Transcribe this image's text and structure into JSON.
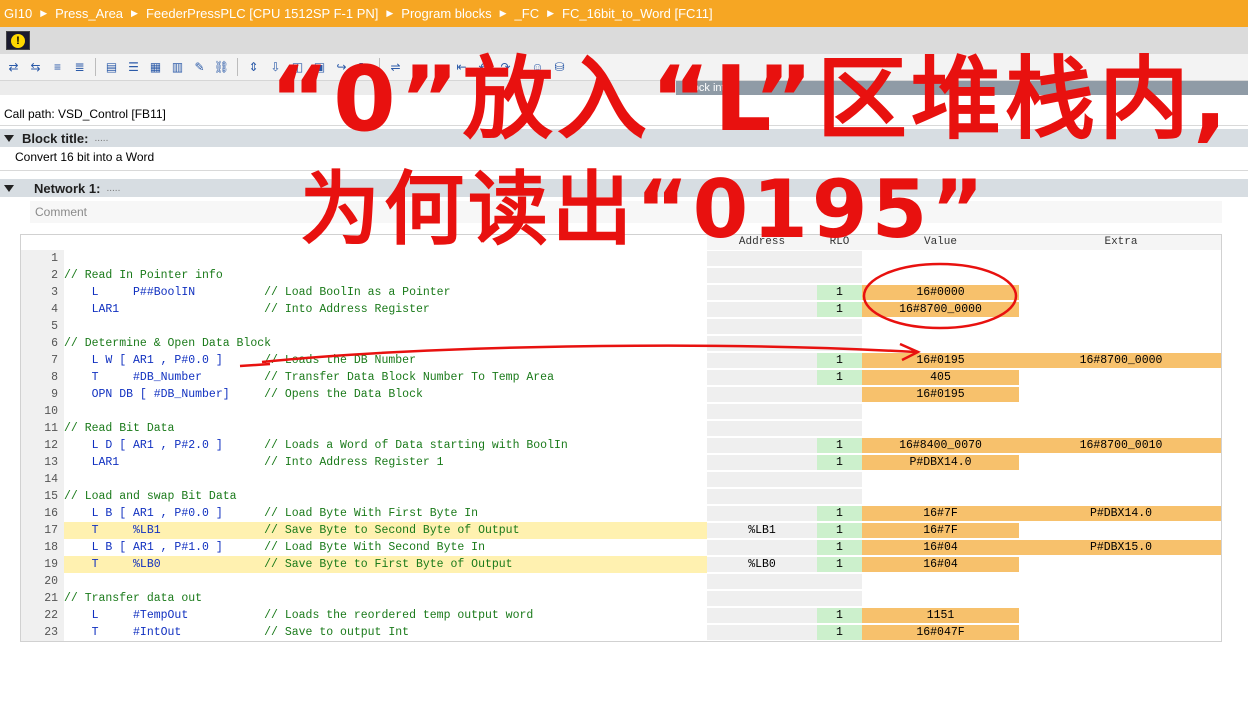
{
  "breadcrumb": [
    "GI10",
    "Press_Area",
    "FeederPressPLC [CPU 1512SP F-1 PN]",
    "Program blocks",
    "_FC",
    "FC_16bit_to_Word [FC11]"
  ],
  "warning_icon": "warning-exclamation-icon",
  "toolbar_icons": [
    "go-online-icon",
    "go-offline-icon",
    "insert-network-icon",
    "delete-network-icon",
    "monitor-icon",
    "list-icon",
    "grid-icon",
    "table-icon",
    "comment-icon",
    "link-icon",
    "scroll-icon",
    "download-icon",
    "view-icon",
    "select-icon",
    "goto-icon",
    "refresh-icon",
    "compare-icon",
    "call-icon",
    "indent-icon",
    "outdent-icon",
    "back-icon",
    "forward-icon",
    "user-icon",
    "database-icon"
  ],
  "block_interface_tab": "Block inte",
  "call_path": "Call path: VSD_Control [FB11]",
  "block_title_label": "Block title:",
  "block_title_dots": ".....",
  "block_description": "Convert 16 bit into a Word",
  "network_label": "Network 1:",
  "network_dots": ".....",
  "network_comment_placeholder": "Comment",
  "columns": {
    "address": "Address",
    "rlo": "RLO",
    "value": "Value",
    "extra": "Extra"
  },
  "code_lines": [
    {
      "n": "1",
      "code": "",
      "kind": "blank"
    },
    {
      "n": "2",
      "code": "// Read In Pointer info",
      "kind": "comment"
    },
    {
      "n": "3",
      "code": "    L     P##BoolIN          // Load BoolIn as a Pointer",
      "kind": "instr",
      "addr": "",
      "rlo": "1",
      "val": "16#0000",
      "ext": ""
    },
    {
      "n": "4",
      "code": "    LAR1                     // Into Address Register",
      "kind": "instr",
      "addr": "",
      "rlo": "1",
      "val": "16#8700_0000",
      "ext": ""
    },
    {
      "n": "5",
      "code": "",
      "kind": "blank"
    },
    {
      "n": "6",
      "code": "// Determine & Open Data Block",
      "kind": "comment"
    },
    {
      "n": "7",
      "code": "    L W [ AR1 , P#0.0 ]      // Loads the DB Number",
      "kind": "instr",
      "addr": "",
      "rlo": "1",
      "val": "16#0195",
      "ext": "16#8700_0000"
    },
    {
      "n": "8",
      "code": "    T     #DB_Number         // Transfer Data Block Number To Temp Area",
      "kind": "instr",
      "addr": "",
      "rlo": "1",
      "val": "405",
      "ext": ""
    },
    {
      "n": "9",
      "code": "    OPN DB [ #DB_Number]     // Opens the Data Block",
      "kind": "instr",
      "addr": "",
      "rlo": "",
      "val": "16#0195",
      "ext": ""
    },
    {
      "n": "10",
      "code": "",
      "kind": "blank"
    },
    {
      "n": "11",
      "code": "// Read Bit Data",
      "kind": "comment"
    },
    {
      "n": "12",
      "code": "    L D [ AR1 , P#2.0 ]      // Loads a Word of Data starting with BoolIn",
      "kind": "instr",
      "addr": "",
      "rlo": "1",
      "val": "16#8400_0070",
      "ext": "16#8700_0010"
    },
    {
      "n": "13",
      "code": "    LAR1                     // Into Address Register 1",
      "kind": "instr",
      "addr": "",
      "rlo": "1",
      "val": "P#DBX14.0",
      "ext": ""
    },
    {
      "n": "14",
      "code": "",
      "kind": "blank"
    },
    {
      "n": "15",
      "code": "// Load and swap Bit Data",
      "kind": "comment"
    },
    {
      "n": "16",
      "code": "    L B [ AR1 , P#0.0 ]      // Load Byte With First Byte In",
      "kind": "instr",
      "addr": "",
      "rlo": "1",
      "val": "16#7F",
      "ext": "P#DBX14.0"
    },
    {
      "n": "17",
      "code": "    T     %LB1               // Save Byte to Second Byte of Output",
      "kind": "instr",
      "hl": true,
      "addr": "%LB1",
      "rlo": "1",
      "val": "16#7F",
      "ext": ""
    },
    {
      "n": "18",
      "code": "    L B [ AR1 , P#1.0 ]      // Load Byte With Second Byte In",
      "kind": "instr",
      "addr": "",
      "rlo": "1",
      "val": "16#04",
      "ext": "P#DBX15.0"
    },
    {
      "n": "19",
      "code": "    T     %LB0               // Save Byte to First Byte of Output",
      "kind": "instr",
      "hl": true,
      "addr": "%LB0",
      "rlo": "1",
      "val": "16#04",
      "ext": ""
    },
    {
      "n": "20",
      "code": "",
      "kind": "blank"
    },
    {
      "n": "21",
      "code": "// Transfer data out",
      "kind": "comment"
    },
    {
      "n": "22",
      "code": "    L     #TempOut           // Loads the reordered temp output word",
      "kind": "instr",
      "addr": "",
      "rlo": "1",
      "val": "1151",
      "ext": ""
    },
    {
      "n": "23",
      "code": "    T     #IntOut            // Save to output Int",
      "kind": "instr",
      "addr": "",
      "rlo": "1",
      "val": "16#047F",
      "ext": ""
    }
  ],
  "annotation": {
    "line1": "“0”放入“L”区堆栈内,",
    "line2": "为何读出“0195”",
    "color": "#e8110f"
  }
}
